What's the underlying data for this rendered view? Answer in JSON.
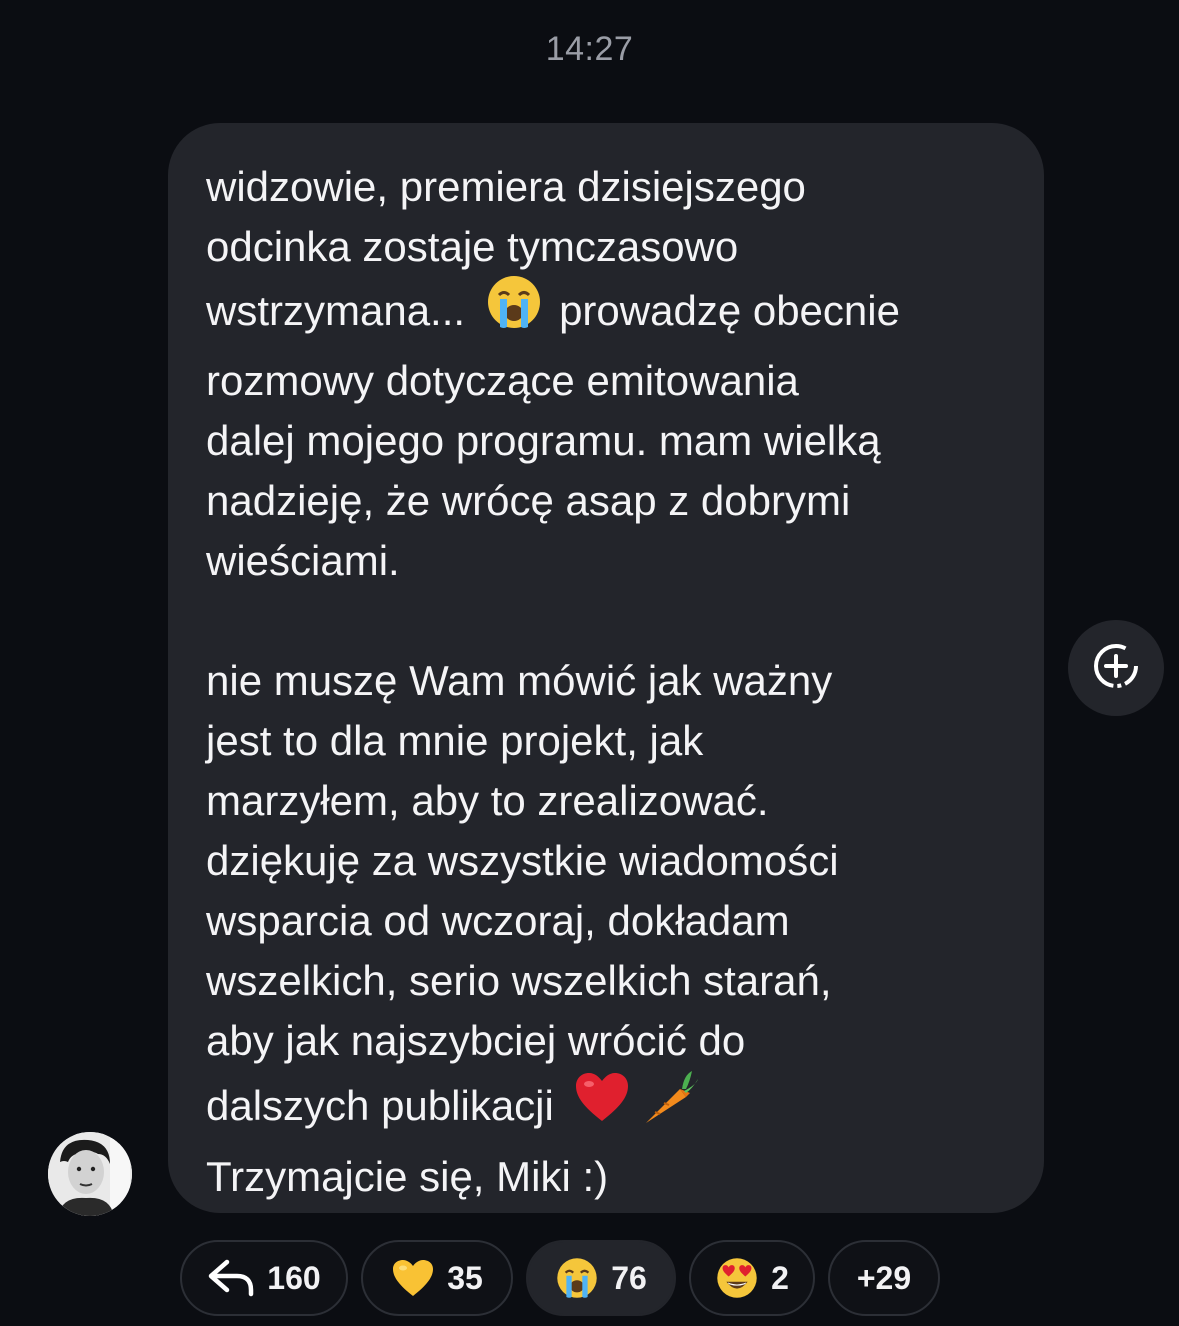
{
  "header": {
    "time": "14:27"
  },
  "message": {
    "paragraph1": [
      "widzowie, premiera dzisiejszego",
      "odcinka zostaje tymczasowo",
      "wstrzymana...",
      "prowadzę obecnie",
      "rozmowy dotyczące emitowania",
      "dalej mojego programu. mam wielką",
      "nadzieję, że wrócę asap z dobrymi",
      "wieściami."
    ],
    "paragraph2": [
      "nie muszę Wam mówić jak ważny",
      "jest to dla mnie projekt, jak",
      "marzyłem, aby to zrealizować.",
      "dziękuję za wszystkie wiadomości",
      "wsparcia od wczoraj, dokładam",
      "wszelkich, serio wszelkich starań,",
      "aby jak najszybciej wrócić do",
      "dalszych publikacji",
      "Trzymajcie się, Miki :)"
    ],
    "inline_emojis": [
      "loudly-crying-face",
      "red-heart",
      "carrot"
    ]
  },
  "reactions": [
    {
      "icon": "reply-arrow-icon",
      "count": "160",
      "active": false
    },
    {
      "icon": "yellow-heart-icon",
      "count": "35",
      "active": false
    },
    {
      "icon": "loudly-crying-face-icon",
      "count": "76",
      "active": true
    },
    {
      "icon": "heart-eyes-face-icon",
      "count": "2",
      "active": false
    },
    {
      "icon": "more-reactions",
      "count": "+29",
      "active": false
    }
  ],
  "colors": {
    "background": "#0b0d12",
    "bubble": "#23252b",
    "text": "#f4f4f6",
    "timestamp": "#9a9da6"
  }
}
